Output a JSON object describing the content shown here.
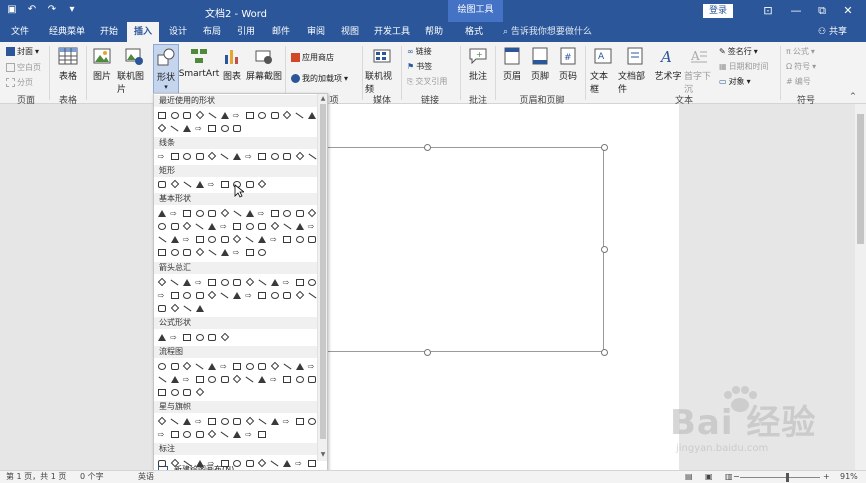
{
  "titlebar": {
    "title": "文档2 - Word",
    "context_tab": "绘图工具",
    "login": "登录",
    "restore_glyph": "⧉",
    "minimize_glyph": "—",
    "close_glyph": "✕"
  },
  "tabs": [
    {
      "label": "文件"
    },
    {
      "label": "经典菜单"
    },
    {
      "label": "开始"
    },
    {
      "label": "插入",
      "active": true
    },
    {
      "label": "设计"
    },
    {
      "label": "布局"
    },
    {
      "label": "引用"
    },
    {
      "label": "邮件"
    },
    {
      "label": "审阅"
    },
    {
      "label": "视图"
    },
    {
      "label": "开发工具"
    },
    {
      "label": "帮助"
    },
    {
      "label": "格式"
    }
  ],
  "tell_me": "告诉我你想要做什么",
  "share": "共享",
  "ribbon": {
    "cover": "封面",
    "blank_page": "空白页",
    "page_break": "分页",
    "group_pages": "页面",
    "table": "表格",
    "group_table": "表格",
    "picture": "图片",
    "online_picture": "联机图片",
    "shapes": "形状",
    "smartart": "SmartArt",
    "chart": "图表",
    "screenshot": "屏幕截图",
    "app_store": "应用商店",
    "my_addins": "我的加载项",
    "group_addins": "项",
    "online_video": "联机视频",
    "group_media": "媒体",
    "link": "链接",
    "bookmark": "书签",
    "cross_ref": "交叉引用",
    "group_links": "链接",
    "comment": "批注",
    "group_comments": "批注",
    "header": "页眉",
    "footer": "页脚",
    "page_number": "页码",
    "group_header_footer": "页眉和页脚",
    "textbox": "文本框",
    "doc_parts": "文档部件",
    "wordart": "艺术字",
    "drop_cap": "首字下沉",
    "signature_line": "签名行",
    "datetime": "日期和时间",
    "object": "对象",
    "group_text": "文本",
    "equation": "公式",
    "symbol": "符号",
    "numbering": "编号",
    "group_symbols": "符号"
  },
  "shapes_menu": {
    "recent": "最近使用的形状",
    "lines": "线条",
    "rectangles": "矩形",
    "basic": "基本形状",
    "arrows": "箭头总汇",
    "equation_shapes": "公式形状",
    "flowchart": "流程图",
    "stars": "星与旗帜",
    "callouts": "标注",
    "new_canvas": "新建绘图画布(N)"
  },
  "status": {
    "page": "第 1 页，共 1 页",
    "words": "0 个字",
    "lang": "英语",
    "zoom": "91%"
  },
  "watermark": {
    "brand": "Bai 经验",
    "url": "jingyan.baidu.com"
  },
  "colors": {
    "accent": "#2b579a",
    "context": "#4472c4",
    "ribbon_bg": "#f3f3f3"
  }
}
